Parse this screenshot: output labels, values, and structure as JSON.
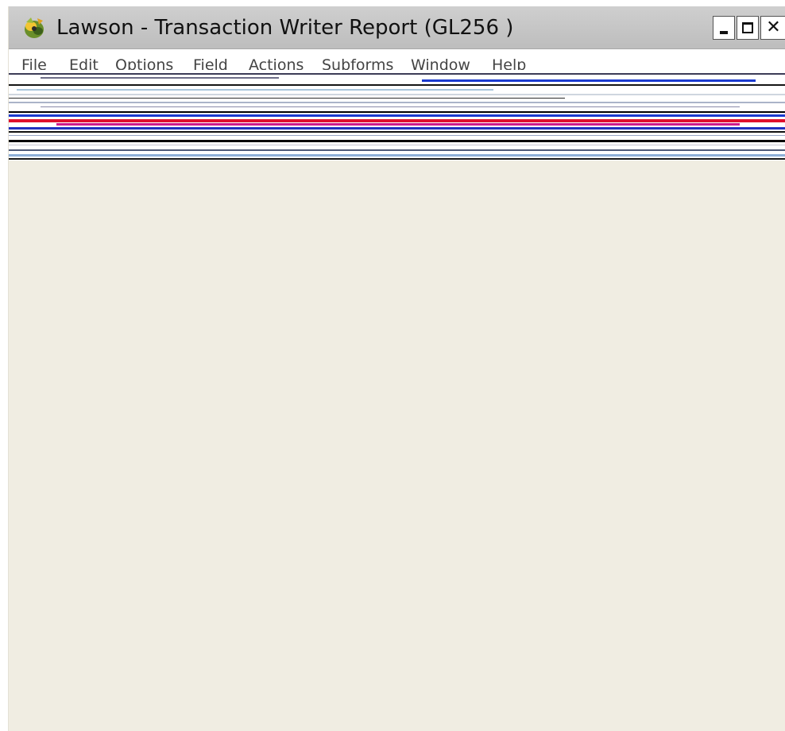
{
  "window": {
    "title": "Lawson - Transaction Writer Report (GL256 )",
    "icon": "lawson-app-icon",
    "controls": {
      "minimize_icon": "minimize-icon",
      "maximize_icon": "maximize-icon",
      "close_icon": "close-icon"
    }
  },
  "menu": {
    "items": [
      {
        "label": "File"
      },
      {
        "label": "Edit"
      },
      {
        "label": "Options"
      },
      {
        "label": "Field"
      },
      {
        "label": "Actions"
      },
      {
        "label": "Subforms"
      },
      {
        "label": "Window"
      },
      {
        "label": "Help"
      }
    ]
  },
  "colors": {
    "content_background": "#f0ede2",
    "titlebar": "#c6c6c6",
    "glitch_accent_red": "#e0102e",
    "glitch_accent_magenta": "#d01a8a",
    "glitch_accent_blue": "#1a3ad0"
  }
}
